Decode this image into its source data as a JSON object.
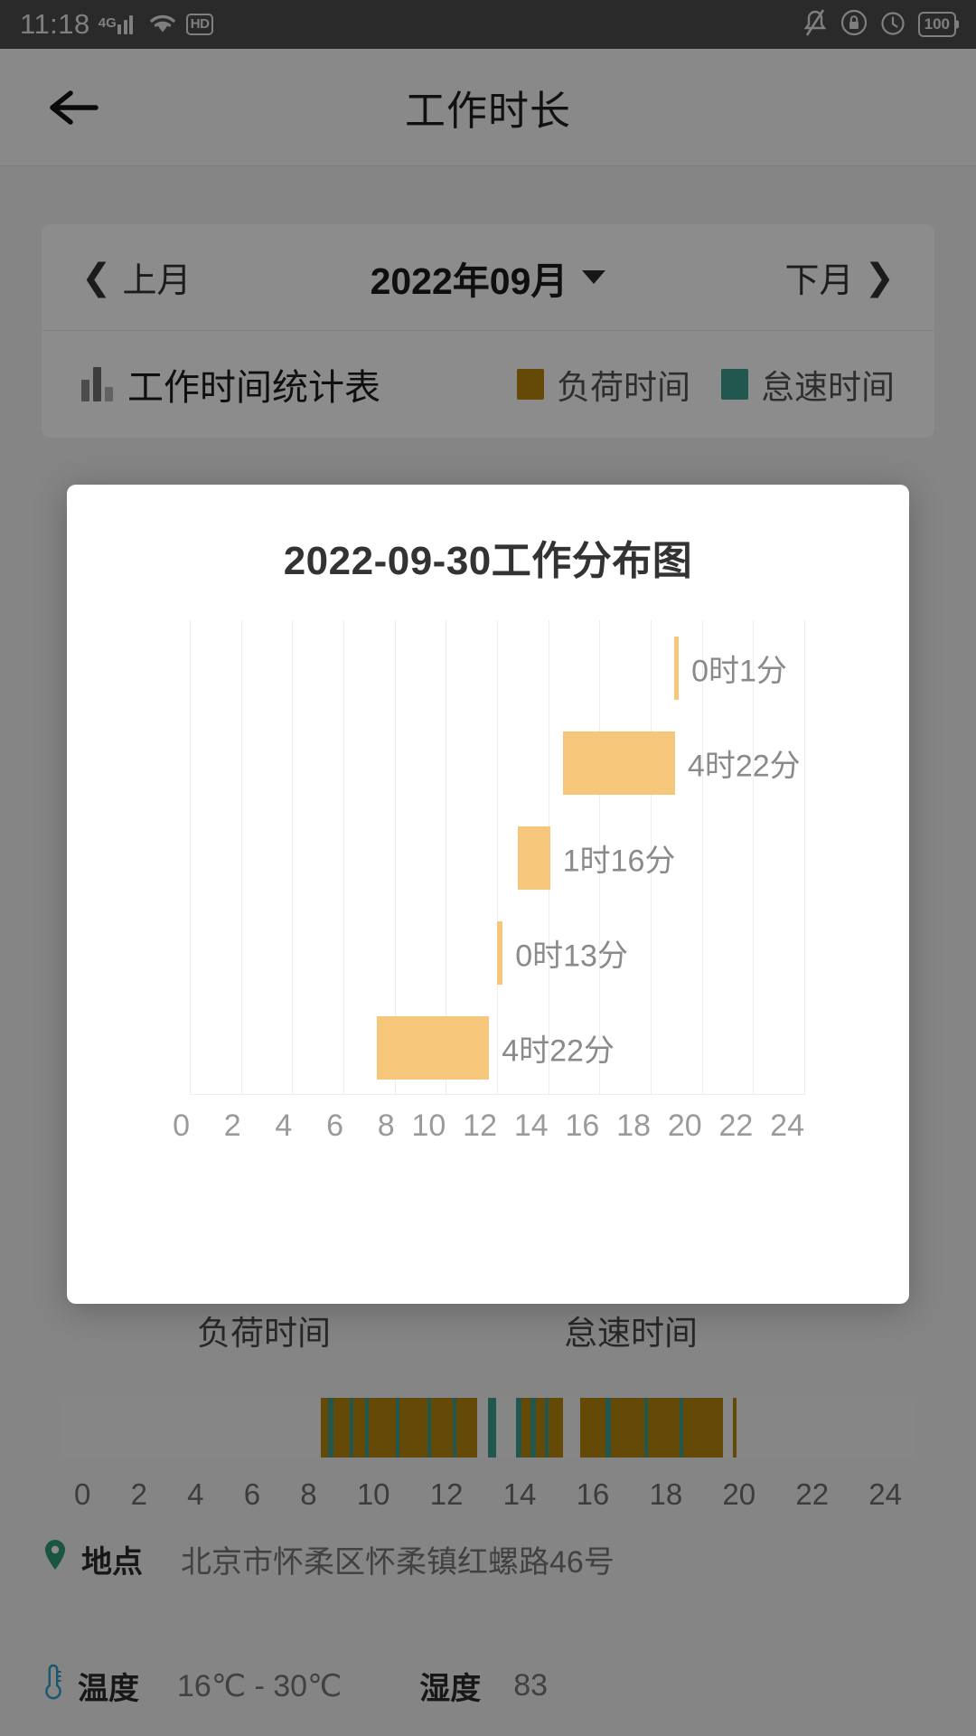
{
  "statusbar": {
    "time": "11:18",
    "network_type": "4G",
    "hd_label": "HD",
    "battery": "100",
    "icons": [
      "signal-icon",
      "wifi-icon",
      "hd-icon",
      "mute-bell-icon",
      "lock-icon",
      "alarm-icon",
      "battery-icon"
    ]
  },
  "header": {
    "title": "工作时长",
    "back_icon": "back-arrow-icon"
  },
  "month_selector": {
    "prev_label": "上月",
    "current": "2022年09月",
    "next_label": "下月"
  },
  "stats_header": {
    "title": "工作时间统计表",
    "legend": [
      {
        "label": "负荷时间",
        "color": "#b8860b"
      },
      {
        "label": "怠速时间",
        "color": "#3f9e90"
      }
    ]
  },
  "timeline": {
    "label_load": "负荷时间",
    "label_idle": "怠速时间",
    "ticks": [
      "0",
      "2",
      "4",
      "6",
      "8",
      "10",
      "12",
      "14",
      "16",
      "18",
      "20",
      "22",
      "24"
    ],
    "segments": [
      {
        "start": 7.3,
        "end": 7.5,
        "type": "load"
      },
      {
        "start": 7.5,
        "end": 7.65,
        "type": "idle"
      },
      {
        "start": 7.65,
        "end": 8.1,
        "type": "load"
      },
      {
        "start": 8.1,
        "end": 8.2,
        "type": "idle"
      },
      {
        "start": 8.2,
        "end": 8.55,
        "type": "load"
      },
      {
        "start": 8.55,
        "end": 8.65,
        "type": "idle"
      },
      {
        "start": 8.65,
        "end": 9.4,
        "type": "load"
      },
      {
        "start": 9.4,
        "end": 9.5,
        "type": "idle"
      },
      {
        "start": 9.5,
        "end": 10.3,
        "type": "load"
      },
      {
        "start": 10.3,
        "end": 10.4,
        "type": "idle"
      },
      {
        "start": 10.4,
        "end": 11.0,
        "type": "load"
      },
      {
        "start": 11.0,
        "end": 11.1,
        "type": "idle"
      },
      {
        "start": 11.1,
        "end": 11.7,
        "type": "load"
      },
      {
        "start": 12.0,
        "end": 12.22,
        "type": "idle"
      },
      {
        "start": 12.8,
        "end": 12.95,
        "type": "idle"
      },
      {
        "start": 12.95,
        "end": 13.2,
        "type": "load"
      },
      {
        "start": 13.2,
        "end": 13.35,
        "type": "idle"
      },
      {
        "start": 13.35,
        "end": 13.6,
        "type": "load"
      },
      {
        "start": 13.6,
        "end": 13.7,
        "type": "idle"
      },
      {
        "start": 13.7,
        "end": 14.1,
        "type": "load"
      },
      {
        "start": 14.6,
        "end": 15.3,
        "type": "load"
      },
      {
        "start": 15.3,
        "end": 15.45,
        "type": "idle"
      },
      {
        "start": 15.45,
        "end": 16.4,
        "type": "load"
      },
      {
        "start": 16.4,
        "end": 16.5,
        "type": "idle"
      },
      {
        "start": 16.5,
        "end": 17.4,
        "type": "load"
      },
      {
        "start": 17.4,
        "end": 17.5,
        "type": "idle"
      },
      {
        "start": 17.5,
        "end": 18.6,
        "type": "load"
      },
      {
        "start": 18.9,
        "end": 19.0,
        "type": "load"
      }
    ]
  },
  "info": {
    "location_icon": "map-pin-icon",
    "location_label": "地点",
    "location_value": "北京市怀柔区怀柔镇红螺路46号",
    "temp_icon": "thermometer-icon",
    "temp_label": "温度",
    "temp_value": "16℃ - 30℃",
    "humidity_label": "湿度",
    "humidity_value": "83"
  },
  "modal": {
    "title": "2022-09-30工作分布图"
  },
  "chart_data": {
    "type": "bar",
    "orientation": "horizontal-range",
    "title": "2022-09-30工作分布图",
    "xlabel": "",
    "ylabel": "",
    "xlim": [
      0,
      24
    ],
    "grid": true,
    "legend_position": "none",
    "bar_color": "#f6c77a",
    "tick_labels": [
      "0",
      "2",
      "4",
      "6",
      "8",
      "10",
      "12",
      "14",
      "16",
      "18",
      "20",
      "22",
      "24"
    ],
    "tick_values": [
      0,
      2,
      4,
      6,
      8,
      10,
      12,
      14,
      16,
      18,
      20,
      22,
      24
    ],
    "bars": [
      {
        "start": 18.92,
        "end": 19.0,
        "duration_label": "0时1分",
        "duration_hours": 0.0167
      },
      {
        "start": 14.58,
        "end": 18.95,
        "duration_label": "4时22分",
        "duration_hours": 4.3667
      },
      {
        "start": 12.8,
        "end": 14.07,
        "duration_label": "1时16分",
        "duration_hours": 1.2667
      },
      {
        "start": 12.0,
        "end": 12.22,
        "duration_label": "0时13分",
        "duration_hours": 0.2167
      },
      {
        "start": 7.32,
        "end": 11.69,
        "duration_label": "4时22分",
        "duration_hours": 4.3667
      }
    ]
  }
}
